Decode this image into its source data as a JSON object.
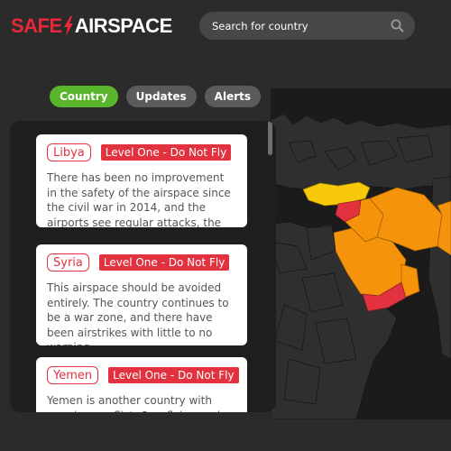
{
  "brand": {
    "part1": "SAFE",
    "part2": "AIRSPACE"
  },
  "search": {
    "placeholder": "Search for country"
  },
  "tabs": [
    {
      "label": "Country",
      "active": true
    },
    {
      "label": "Updates",
      "active": false
    },
    {
      "label": "Alerts",
      "active": false
    }
  ],
  "cards": [
    {
      "country": "Libya",
      "level": "Level One - Do Not Fly",
      "text": "There has been no improvement in the safety of the airspace since the civil war in 2014, and the airports see regular attacks, the latest in"
    },
    {
      "country": "Syria",
      "level": "Level One - Do Not Fly",
      "text": "This airspace should be avoided entirely. The country continues to be a war zone, and there have been airstrikes with little to no warning."
    },
    {
      "country": "Yemen",
      "level": "Level One - Do Not Fly",
      "text": "Yemen is another country with ongoing conflict. Overflying and"
    }
  ],
  "colors": {
    "brand_red": "#e8273a",
    "active_tab": "#59b52b",
    "level_red": "#e2323f",
    "map_orange": "#f5940a",
    "map_yellow": "#f8c90a"
  },
  "icons": {
    "search": "search-icon",
    "logo_bolt": "lightning-bolt-icon"
  }
}
